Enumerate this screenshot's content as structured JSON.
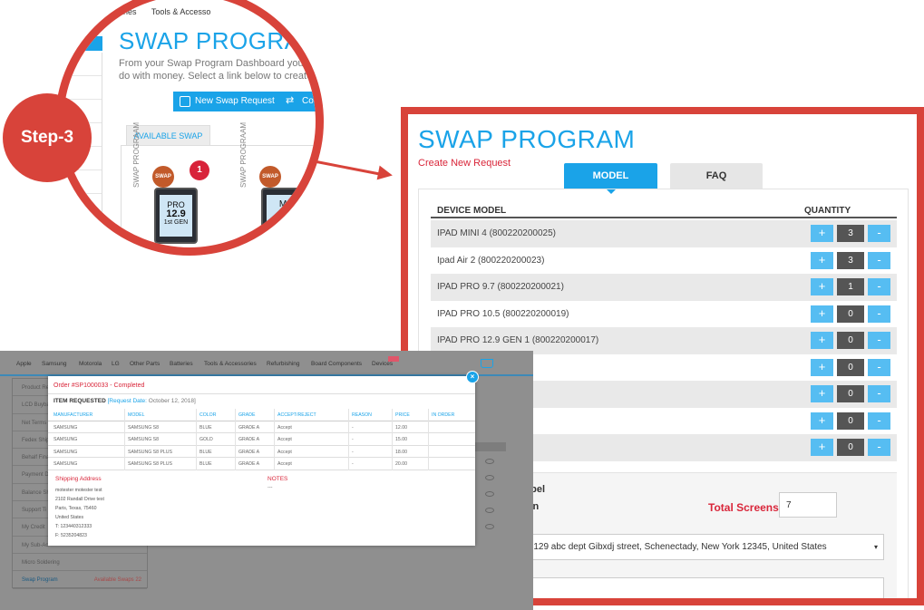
{
  "step": {
    "label": "Step-3"
  },
  "zoom": {
    "nav": [
      "eries",
      "Tools & Accesso"
    ],
    "title": "SWAP PROGRAM",
    "desc_line1": "From your Swap Program Dashboard you have",
    "desc_line2": "do with money. Select a link below to create ord",
    "btn_new": "New Swap Request",
    "btn_collect": "Collect My Swaps",
    "tab_available": "AVAILABLE SWAP",
    "product_vertical": "SWAP PROGRAAM",
    "seal_text": "SWAP",
    "ipad_line1": "PRO",
    "ipad_line2": "12.9",
    "ipad_line3": "1st GEN",
    "badge_count": "1",
    "ipad2_partial": "M"
  },
  "swap": {
    "title": "SWAP PROGRAM",
    "subtitle": "Create New Request",
    "tab_model": "MODEL",
    "tab_faq": "FAQ",
    "col_device": "DEVICE MODEL",
    "col_qty": "QUANTITY",
    "plus": "+",
    "minus": "-",
    "rows": [
      {
        "name": "IPAD MINI 4 (800220200025)",
        "qty": "3"
      },
      {
        "name": "Ipad Air 2 (800220200023)",
        "qty": "3"
      },
      {
        "name": "IPAD PRO 9.7 (800220200021)",
        "qty": "1"
      },
      {
        "name": "IPAD PRO 10.5 (800220200019)",
        "qty": "0"
      },
      {
        "name": "IPAD PRO 12.9 GEN 1 (800220200017)",
        "qty": "0"
      },
      {
        "name": "20200015)",
        "qty": "0"
      },
      {
        "name": "20200011)",
        "qty": "0"
      },
      {
        "name": "0001)",
        "qty": "0"
      },
      {
        "name": "220200006)",
        "qty": "0"
      }
    ],
    "label_partial1": "abel",
    "label_partial2": "wn",
    "total_label": "Total Screens :",
    "total_value": "7",
    "address": "t, 129 abc dept Gibxdj street, Schenectady, New York 12345, United States",
    "select_caret": "▾"
  },
  "bl": {
    "nav": [
      "Apple",
      "Samsung",
      "Motorola",
      "LG",
      "Other Parts",
      "Batteries",
      "Tools & Accessories",
      "Refurbishing",
      "Board Components",
      "Devices"
    ],
    "sidebar": [
      {
        "label": "Product Re",
        "right": ""
      },
      {
        "label": "LCD Buyba",
        "right": ""
      },
      {
        "label": "Net Terms",
        "right": ""
      },
      {
        "label": "Fedex Ship",
        "right": ""
      },
      {
        "label": "Behalf Fina",
        "right": ""
      },
      {
        "label": "Payment D",
        "right": ""
      },
      {
        "label": "Balance Sh",
        "right": ""
      },
      {
        "label": "Support Ti",
        "right": ""
      },
      {
        "label": "My Credit",
        "right": ""
      },
      {
        "label": "My Sub-Ac",
        "right": ""
      },
      {
        "label": "Micro Soldering",
        "right": ""
      },
      {
        "label": "Swap Program",
        "right": "Available Swaps  22"
      }
    ],
    "modal": {
      "order": "Order #SP1000033 - Completed",
      "item_requested": "ITEM REQUESTED",
      "request_date_label": "Request Date:",
      "request_date": "October 12, 2018",
      "headers": [
        "MANUFACTURER",
        "MODEL",
        "COLOR",
        "GRADE",
        "ACCEPT/REJECT",
        "REASON",
        "PRICE",
        "IN ORDER"
      ],
      "rows": [
        [
          "SAMSUNG",
          "SAMSUNG S8",
          "BLUE",
          "GRADE A",
          "Accept",
          "-",
          "12.00",
          ""
        ],
        [
          "SAMSUNG",
          "SAMSUNG S8",
          "GOLD",
          "GRADE A",
          "Accept",
          "-",
          "15.00",
          ""
        ],
        [
          "SAMSUNG",
          "SAMSUNG S8 PLUS",
          "BLUE",
          "GRADE A",
          "Accept",
          "-",
          "18.00",
          ""
        ],
        [
          "SAMSUNG",
          "SAMSUNG S8 PLUS",
          "BLUE",
          "GRADE A",
          "Accept",
          "-",
          "20.00",
          ""
        ]
      ],
      "shipping_label": "Shipping Address",
      "address_lines": [
        "motester motester test",
        "2102 Randall Drive test",
        "Paris, Texas, 75460",
        "United States",
        "T: 123440312333",
        "F: 5235204823"
      ],
      "notes_label": "NOTES",
      "notes_value": "---",
      "close": "×"
    }
  },
  "colors": {
    "accent": "#1aa3e8",
    "highlight": "#d8433a",
    "alert": "#d9263a"
  }
}
